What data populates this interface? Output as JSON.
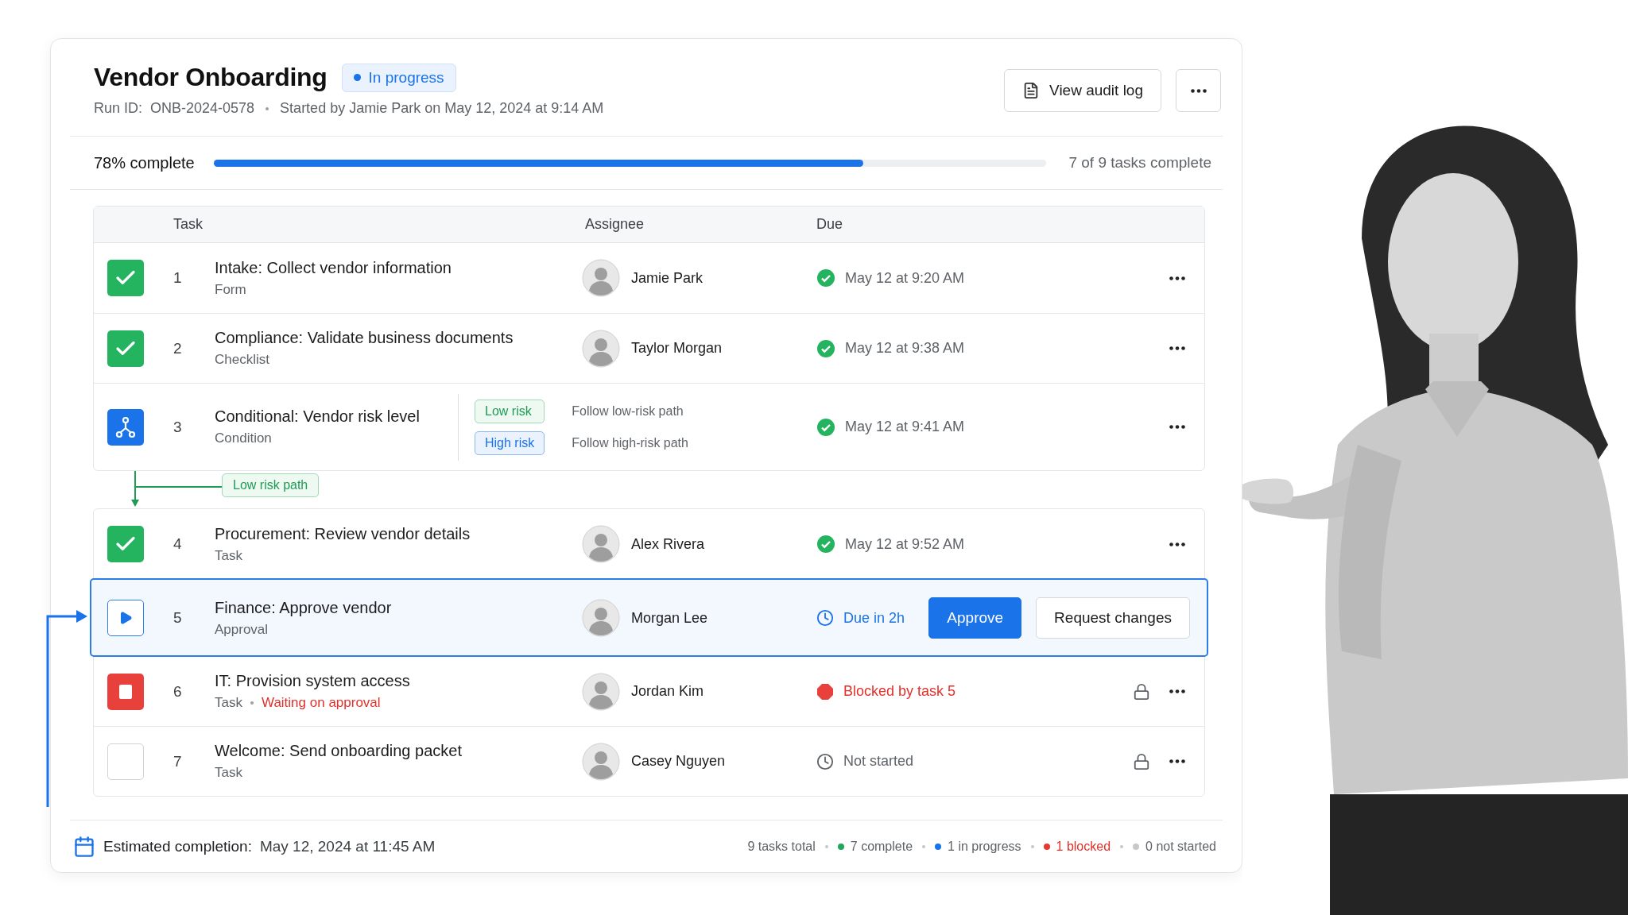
{
  "header": {
    "title": "Vendor Onboarding",
    "status_badge": "In progress",
    "run_id": "Run ID:  ONB-2024-0578",
    "started": "Started by Jamie Park on May 12, 2024 at 9:14 AM",
    "audit_button": "View audit log"
  },
  "progress": {
    "label": "78% complete",
    "level": 0.78,
    "summary": "7 of 9 tasks complete"
  },
  "table": {
    "columns": [
      "Task",
      "Assignee",
      "Due"
    ],
    "rows": [
      {
        "number": "1",
        "kind": "complete",
        "selected": false,
        "title": "Intake: Collect vendor information",
        "type": "Form",
        "assignee": "Jamie Park",
        "due": {
          "kind": "done",
          "text": "May 12 at 9:20 AM"
        },
        "locked": false
      },
      {
        "number": "2",
        "kind": "complete",
        "selected": false,
        "title": "Compliance: Validate business documents",
        "type": "Checklist",
        "assignee": "Taylor Morgan",
        "due": {
          "kind": "done",
          "text": "May 12 at 9:38 AM"
        },
        "locked": false
      },
      {
        "number": "3",
        "kind": "condition",
        "selected": false,
        "title": "Conditional: Vendor risk level",
        "type": "Condition",
        "branches": [
          {
            "label": "Low risk",
            "kind": "low",
            "text": "Follow low-risk path"
          },
          {
            "label": "High risk",
            "kind": "high",
            "text": "Follow high-risk path"
          }
        ],
        "due": {
          "kind": "done",
          "text": "May 12 at 9:41 AM"
        },
        "locked": false
      },
      {
        "number": "4",
        "kind": "complete",
        "selected": false,
        "title": "Procurement: Review vendor details",
        "type": "Task",
        "assignee": "Alex Rivera",
        "due": {
          "kind": "done",
          "text": "May 12 at 9:52 AM"
        },
        "locked": false
      },
      {
        "number": "5",
        "kind": "in_progress",
        "selected": true,
        "title": "Finance: Approve vendor",
        "type": "Approval",
        "assignee": "Morgan Lee",
        "due": {
          "kind": "countdown",
          "text": "Due in 2h"
        },
        "locked": false,
        "actions": [
          {
            "label": "Approve",
            "kind": "primary"
          },
          {
            "label": "Request changes",
            "kind": "secondary"
          }
        ]
      },
      {
        "number": "6",
        "kind": "blocked",
        "selected": false,
        "title": "IT: Provision system access",
        "type": "Task",
        "note": "Waiting on approval",
        "assignee": "Jordan Kim",
        "due": {
          "kind": "blocked",
          "text": "Blocked by task 5"
        },
        "locked": true
      },
      {
        "number": "7",
        "kind": "not_started",
        "selected": false,
        "title": "Welcome: Send onboarding packet",
        "type": "Task",
        "assignee": "Casey Nguyen",
        "due": {
          "kind": "not_started",
          "text": "Not started"
        },
        "locked": true
      }
    ],
    "path_label": "Low risk path"
  },
  "footer": {
    "label": "Estimated completion:",
    "value": "May 12, 2024 at 11:45 AM",
    "stats": [
      {
        "label": "9 tasks total",
        "kind": "plain"
      },
      {
        "label": "7 complete",
        "kind": "plain",
        "color": "#1fa85a"
      },
      {
        "label": "1 in progress",
        "kind": "plain",
        "color": "#1a73e8"
      },
      {
        "label": "1 blocked",
        "kind": "alert",
        "color": "#e53935"
      },
      {
        "label": "0 not started",
        "kind": "plain",
        "color": "#c8c8c8"
      }
    ]
  }
}
